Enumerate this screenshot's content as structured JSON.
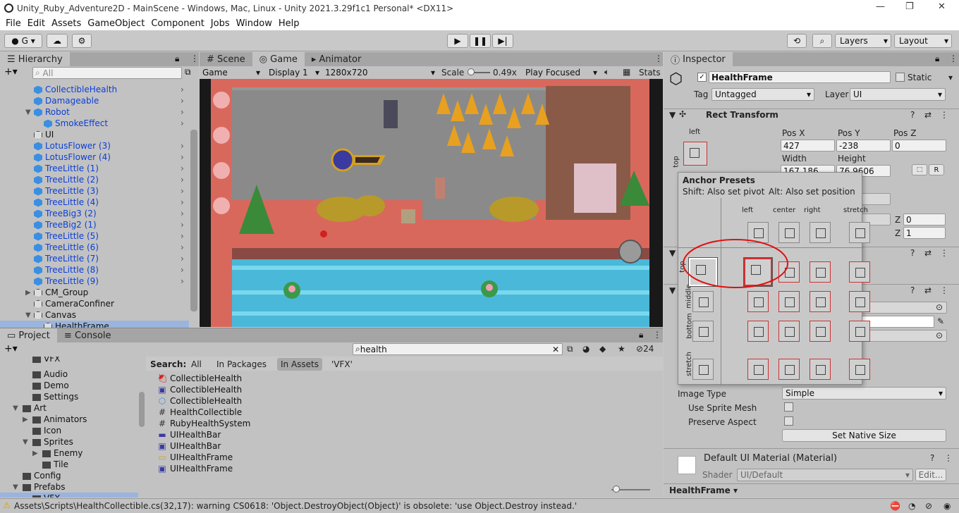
{
  "window": {
    "title": "Unity_Ruby_Adventure2D - MainScene - Windows, Mac, Linux - Unity 2021.3.29f1c1 Personal* <DX11>"
  },
  "menu": [
    "File",
    "Edit",
    "Assets",
    "GameObject",
    "Component",
    "Jobs",
    "Window",
    "Help"
  ],
  "toolbar": {
    "account": "G",
    "layers": "Layers",
    "layout": "Layout"
  },
  "hierarchy": {
    "tab": "Hierarchy",
    "search_placeholder": "All",
    "items": [
      {
        "label": "CollectibleHealth",
        "indent": 3,
        "blue": true,
        "chev": true
      },
      {
        "label": "Damageable",
        "indent": 3,
        "blue": true,
        "chev": true
      },
      {
        "label": "Robot",
        "indent": 3,
        "blue": true,
        "chev": true,
        "expanded": true
      },
      {
        "label": "SmokeEffect",
        "indent": 4,
        "blue": true,
        "chev": true
      },
      {
        "label": "UI",
        "indent": 3,
        "blue": false,
        "chev": false
      },
      {
        "label": "LotusFlower (3)",
        "indent": 3,
        "blue": true,
        "chev": true
      },
      {
        "label": "LotusFlower (4)",
        "indent": 3,
        "blue": true,
        "chev": true
      },
      {
        "label": "TreeLittle (1)",
        "indent": 3,
        "blue": true,
        "chev": true
      },
      {
        "label": "TreeLittle (2)",
        "indent": 3,
        "blue": true,
        "chev": true
      },
      {
        "label": "TreeLittle (3)",
        "indent": 3,
        "blue": true,
        "chev": true
      },
      {
        "label": "TreeLittle (4)",
        "indent": 3,
        "blue": true,
        "chev": true
      },
      {
        "label": "TreeBig3 (2)",
        "indent": 3,
        "blue": true,
        "chev": true
      },
      {
        "label": "TreeBig2 (1)",
        "indent": 3,
        "blue": true,
        "chev": true
      },
      {
        "label": "TreeLittle (5)",
        "indent": 3,
        "blue": true,
        "chev": true
      },
      {
        "label": "TreeLittle (6)",
        "indent": 3,
        "blue": true,
        "chev": true
      },
      {
        "label": "TreeLittle (7)",
        "indent": 3,
        "blue": true,
        "chev": true
      },
      {
        "label": "TreeLittle (8)",
        "indent": 3,
        "blue": true,
        "chev": true
      },
      {
        "label": "TreeLittle (9)",
        "indent": 3,
        "blue": true,
        "chev": true
      },
      {
        "label": "CM_Group",
        "indent": 3,
        "blue": false,
        "chev": false,
        "collapsed": true
      },
      {
        "label": "CameraConfiner",
        "indent": 3,
        "blue": false,
        "chev": false
      },
      {
        "label": "Canvas",
        "indent": 3,
        "blue": false,
        "chev": false,
        "expanded": true
      },
      {
        "label": "HealthFrame",
        "indent": 4,
        "blue": false,
        "chev": false,
        "selected": true
      }
    ]
  },
  "game": {
    "tabs": [
      "Scene",
      "Game",
      "Animator"
    ],
    "display_mode": "Game",
    "display": "Display 1",
    "resolution": "1280x720",
    "scale_label": "Scale",
    "scale_value": "0.49x",
    "play_focused": "Play Focused",
    "stats": "Stats"
  },
  "project": {
    "tabs": [
      "Project",
      "Console"
    ],
    "search": "health",
    "count": "24",
    "search_label": "Search:",
    "filters": [
      "All",
      "In Packages",
      "In Assets",
      "'VFX'"
    ],
    "tree": [
      {
        "label": "VFX",
        "indent": 3,
        "cut": true
      },
      {
        "label": "Audio",
        "indent": 3
      },
      {
        "label": "Demo",
        "indent": 3
      },
      {
        "label": "Settings",
        "indent": 3
      },
      {
        "label": "Art",
        "indent": 2,
        "expanded": true
      },
      {
        "label": "Animators",
        "indent": 3,
        "collapsed": true
      },
      {
        "label": "Icon",
        "indent": 3
      },
      {
        "label": "Sprites",
        "indent": 3,
        "expanded": true
      },
      {
        "label": "Enemy",
        "indent": 4,
        "collapsed": true
      },
      {
        "label": "Tile",
        "indent": 4
      },
      {
        "label": "Config",
        "indent": 2
      },
      {
        "label": "Prefabs",
        "indent": 2,
        "expanded": true
      },
      {
        "label": "VFX",
        "indent": 3,
        "selected": true
      }
    ],
    "results": [
      "CollectibleHealth",
      "CollectibleHealth",
      "CollectibleHealth",
      "HealthCollectible",
      "RubyHealthSystem",
      "UIHealthBar",
      "UIHealthBar",
      "UIHealthFrame",
      "UIHealthFrame"
    ]
  },
  "inspector": {
    "tab": "Inspector",
    "name": "HealthFrame",
    "static": "Static",
    "tag_label": "Tag",
    "tag": "Untagged",
    "layer_label": "Layer",
    "layer": "UI",
    "rect_transform": "Rect Transform",
    "anchor_h": "left",
    "anchor_v": "top",
    "posx_label": "Pos X",
    "posy_label": "Pos Y",
    "posz_label": "Pos Z",
    "posx": "427",
    "posy": "-238",
    "posz": "0",
    "width_label": "Width",
    "height_label": "Height",
    "width": "167.186",
    "height": "76.9606",
    "z1": "0",
    "z2": "1",
    "image_type_label": "Image Type",
    "image_type": "Simple",
    "use_sprite_mesh": "Use Sprite Mesh",
    "preserve_aspect": "Preserve Aspect",
    "set_native": "Set Native Size",
    "material": "Default UI Material (Material)",
    "shader_label": "Shader",
    "shader": "UI/Default",
    "edit": "Edit...",
    "footer": "HealthFrame"
  },
  "anchor_presets": {
    "title": "Anchor Presets",
    "shift": "Shift: Also set pivot",
    "alt": "Alt: Also set position",
    "cols": [
      "left",
      "center",
      "right",
      "stretch"
    ],
    "rows": [
      "top",
      "middle",
      "bottom",
      "stretch"
    ]
  },
  "status": {
    "message": "Assets\\Scripts\\HealthCollectible.cs(32,17): warning CS0618: 'Object.DestroyObject(Object)' is obsolete: 'use Object.Destroy instead.'"
  },
  "colors": {
    "accent": "#3a8fe3",
    "selection": "#4a79c0",
    "warning": "#f2c200"
  }
}
